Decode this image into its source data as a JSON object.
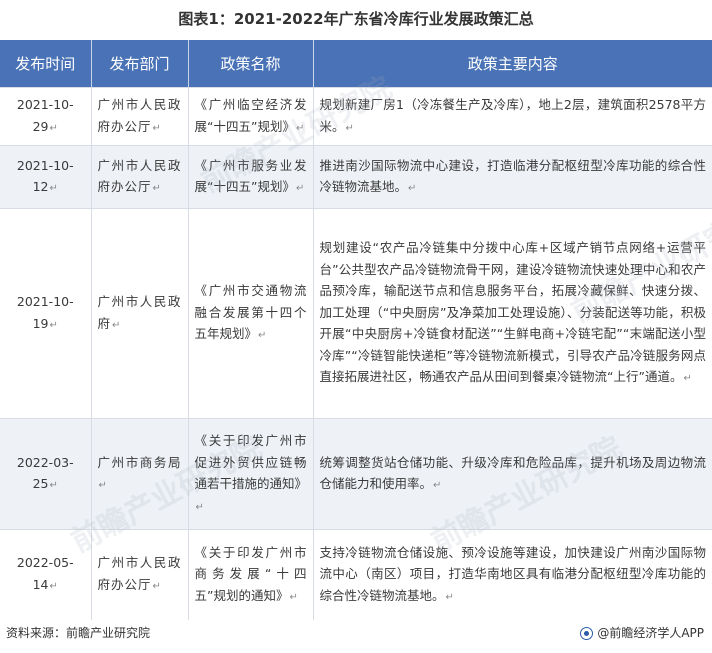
{
  "title": "图表1：2021-2022年广东省冷库行业发展政策汇总",
  "table": {
    "headers": [
      "发布时间",
      "发布部门",
      "政策名称",
      "政策主要内容"
    ],
    "rows": [
      {
        "date": "2021-10-29",
        "dept": "广州市人民政府办公厅",
        "name": "《广州临空经济发展“十四五”规划》",
        "content": "规划新建厂房1（冷冻餐生产及冷库），地上2层，建筑面积2578平方米。"
      },
      {
        "date": "2021-10-12",
        "dept": "广州市人民政府办公厅",
        "name": "《广州市服务业发展“十四五”规划》",
        "content": "推进南沙国际物流中心建设，打造临港分配枢纽型冷库功能的综合性冷链物流基地。"
      },
      {
        "date": "2021-10-19",
        "dept": "广州市人民政府",
        "name": "《广州市交通物流融合发展第十四个五年规划》",
        "content": "规划建设“农产品冷链集中分拨中心库+区域产销节点网络+运营平台”公共型农产品冷链物流骨干网，建设冷链物流快速处理中心和农产品预冷库，输配送节点和信息服务平台，拓展冷藏保鲜、快速分拨、加工处理（“中央厨房”及净菜加工处理设施）、分装配送等功能，积极开展“中央厨房+冷链食材配送”“生鲜电商+冷链宅配”“末端配送小型冷库”“冷链智能快递柜”等冷链物流新模式，引导农产品冷链服务网点直接拓展进社区，畅通农产品从田间到餐桌冷链物流“上行”通道。"
      },
      {
        "date": "2022-03-25",
        "dept": "广州市商务局",
        "name": "《关于印发广州市促进外贸供应链畅通若干措施的通知》",
        "content": "统筹调整货站仓储功能、升级冷库和危险品库，提升机场及周边物流仓储能力和使用率。"
      },
      {
        "date": "2022-05-14",
        "dept": "广州市人民政府办公厅",
        "name": "《关于印发广州市商务发展“十四五”规划的通知》",
        "content": "支持冷链物流仓储设施、预冷设施等建设，加快建设广州南沙国际物流中心（南区）项目，打造华南地区具有临港分配枢纽型冷库功能的综合性冷链物流基地。"
      }
    ]
  },
  "footer": {
    "source": "资料来源：前瞻产业研究院",
    "brand": "@前瞻经济学人APP"
  },
  "watermark_text": "前瞻产业研究院",
  "colors": {
    "header_bg": "#4a72b6",
    "row_shade": "#eef1f6",
    "brand_icon": "#2b5aa8"
  }
}
